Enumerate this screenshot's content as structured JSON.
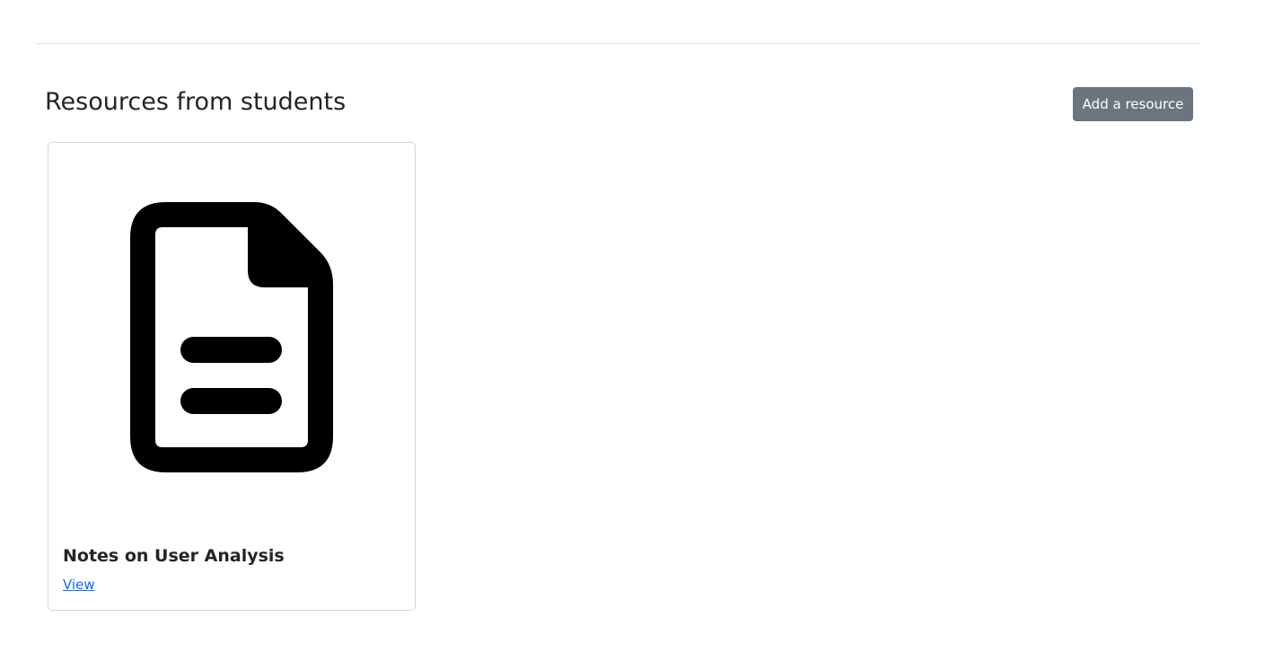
{
  "section": {
    "title": "Resources from students",
    "add_button_label": "Add a resource"
  },
  "resources": [
    {
      "icon": "file-text-icon",
      "title": "Notes on User Analysis",
      "link_label": "View"
    }
  ],
  "colors": {
    "button_bg": "#6c757d",
    "link": "#0d6efd",
    "border": "#d6d6d6"
  }
}
